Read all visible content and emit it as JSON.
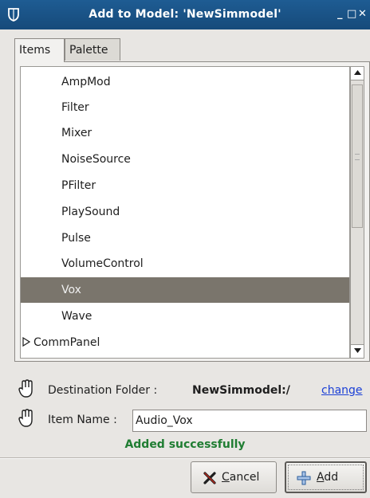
{
  "window": {
    "title": "Add to Model: 'NewSimmodel'",
    "minimize_glyph": "_",
    "maximize_glyph": "□",
    "close_glyph": "✕"
  },
  "tabs": [
    {
      "label": "Items",
      "active": true
    },
    {
      "label": "Palette",
      "active": false
    }
  ],
  "items_list": {
    "rows": [
      {
        "label": "AmpMod",
        "selected": false
      },
      {
        "label": "Filter",
        "selected": false
      },
      {
        "label": "Mixer",
        "selected": false
      },
      {
        "label": "NoiseSource",
        "selected": false
      },
      {
        "label": "PFilter",
        "selected": false
      },
      {
        "label": "PlaySound",
        "selected": false
      },
      {
        "label": "Pulse",
        "selected": false
      },
      {
        "label": "VolumeControl",
        "selected": false
      },
      {
        "label": "Vox",
        "selected": true
      },
      {
        "label": "Wave",
        "selected": false
      }
    ],
    "group": {
      "label": "CommPanel",
      "expanded": false
    }
  },
  "destination": {
    "label": "Destination Folder :",
    "value": "NewSimmodel:/",
    "change_link": "change"
  },
  "item_name": {
    "label": "Item Name :",
    "value": "Audio_Vox"
  },
  "status": {
    "text": "Added successfully",
    "color": "#1f7d32"
  },
  "buttons": {
    "cancel": {
      "mnemonic": "C",
      "rest": "ancel"
    },
    "add": {
      "mnemonic": "A",
      "rest": "dd"
    }
  },
  "colors": {
    "titlebar": "#1e5c93",
    "selection": "#7a756c",
    "link": "#1a3fd6"
  },
  "icons": {
    "app": "shield-icon",
    "hand": "hand-icon",
    "cancel": "x-icon",
    "add": "plus-icon",
    "expander": "triangle-right-icon"
  }
}
